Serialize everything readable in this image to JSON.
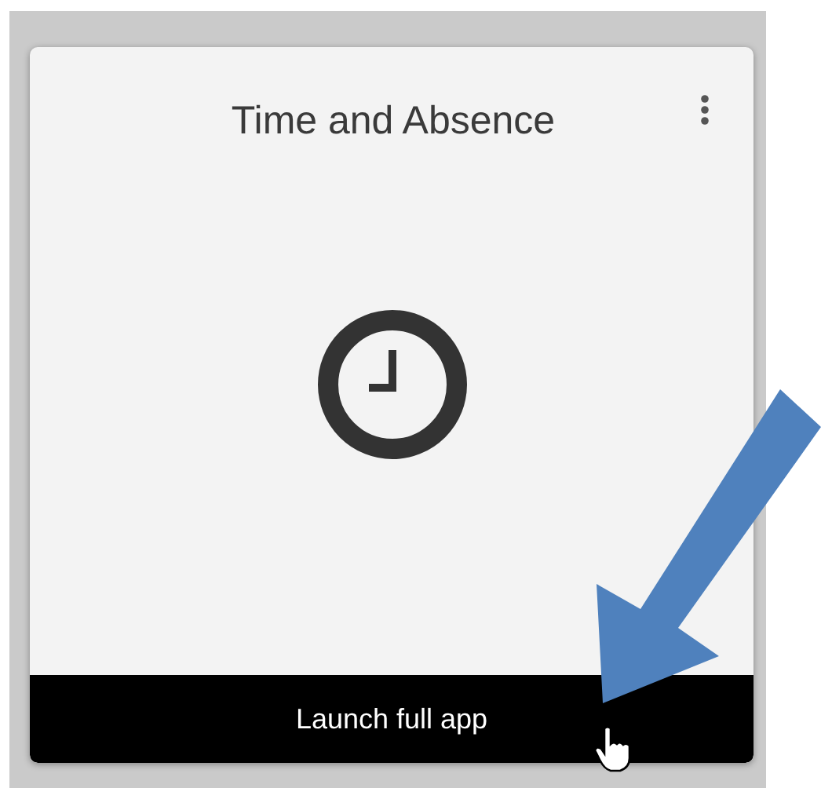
{
  "card": {
    "title": "Time and Absence",
    "launch_button": "Launch full app"
  }
}
